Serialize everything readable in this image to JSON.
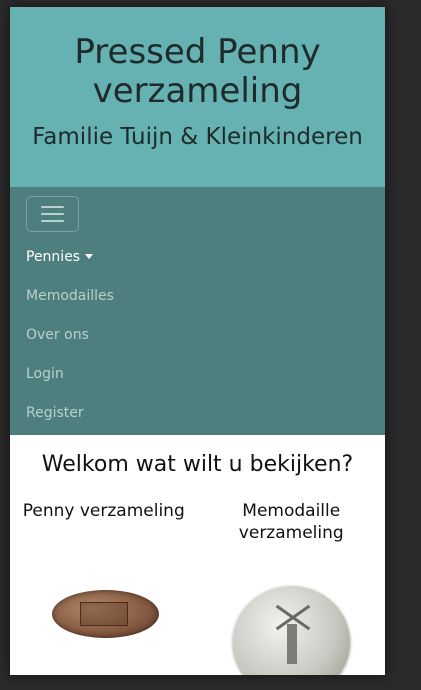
{
  "header": {
    "title": "Pressed Penny verzameling",
    "subtitle": "Familie Tuijn & Kleinkinderen"
  },
  "nav": {
    "items": [
      {
        "label": "Pennies",
        "active": true,
        "has_dropdown": true
      },
      {
        "label": "Memodailles"
      },
      {
        "label": "Over ons"
      },
      {
        "label": "Login"
      },
      {
        "label": "Register"
      }
    ]
  },
  "main": {
    "welcome": "Welkom wat wilt u bekijken?",
    "cards": [
      {
        "title": "Penny verzameling",
        "image": "pressed-penny-image"
      },
      {
        "title": "Memodaille verzameling",
        "image": "memodaille-coin-image"
      }
    ]
  },
  "colors": {
    "header_bg": "#66b2b2",
    "navbar_bg": "#4d7f7e"
  }
}
